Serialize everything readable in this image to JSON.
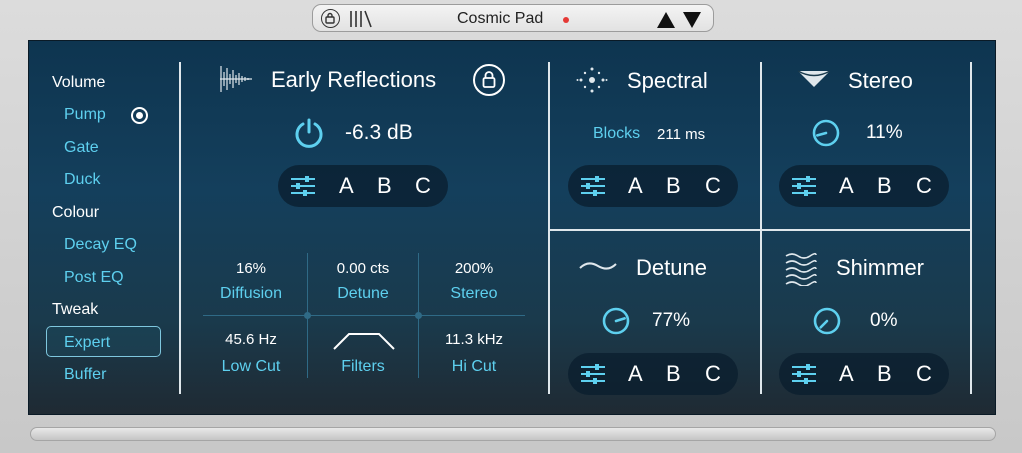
{
  "header": {
    "preset_name": "Cosmic Pad",
    "icons": [
      "lock-icon",
      "library-icon",
      "arrow-up-icon",
      "arrow-down-icon"
    ],
    "modified_indicator_color": "#e53935"
  },
  "sidebar": {
    "sections": [
      {
        "label": "Volume",
        "items": [
          "Pump",
          "Gate",
          "Duck"
        ]
      },
      {
        "label": "Colour",
        "items": [
          "Decay EQ",
          "Post EQ"
        ]
      },
      {
        "label": "Tweak",
        "items": [
          "Expert",
          "Buffer"
        ]
      }
    ],
    "selected_item": "Expert",
    "radio_on_item": "Pump"
  },
  "early_reflections": {
    "title": "Early Reflections",
    "level": "-6.3 dB",
    "slots": [
      "A",
      "B",
      "C"
    ],
    "params": [
      {
        "value": "16%",
        "label": "Diffusion"
      },
      {
        "value": "0.00 cts",
        "label": "Detune"
      },
      {
        "value": "200%",
        "label": "Stereo"
      },
      {
        "value": "45.6 Hz",
        "label": "Low Cut"
      },
      {
        "value": "",
        "label": "Filters"
      },
      {
        "value": "11.3 kHz",
        "label": "Hi Cut"
      }
    ]
  },
  "spectral": {
    "title": "Spectral",
    "param_label": "Blocks",
    "param_value": "211 ms",
    "slots": [
      "A",
      "B",
      "C"
    ]
  },
  "stereo": {
    "title": "Stereo",
    "value": "11%",
    "knob_fraction": 0.11,
    "slots": [
      "A",
      "B",
      "C"
    ]
  },
  "detune": {
    "title": "Detune",
    "value": "77%",
    "knob_fraction": 0.77,
    "slots": [
      "A",
      "B",
      "C"
    ]
  },
  "shimmer": {
    "title": "Shimmer",
    "value": "0%",
    "knob_fraction": 0.0,
    "slots": [
      "A",
      "B",
      "C"
    ]
  },
  "colors": {
    "accent": "#5ed0ef",
    "text": "#ffffff",
    "panel_top": "#0e3550",
    "panel_bottom": "#1f2a33"
  }
}
